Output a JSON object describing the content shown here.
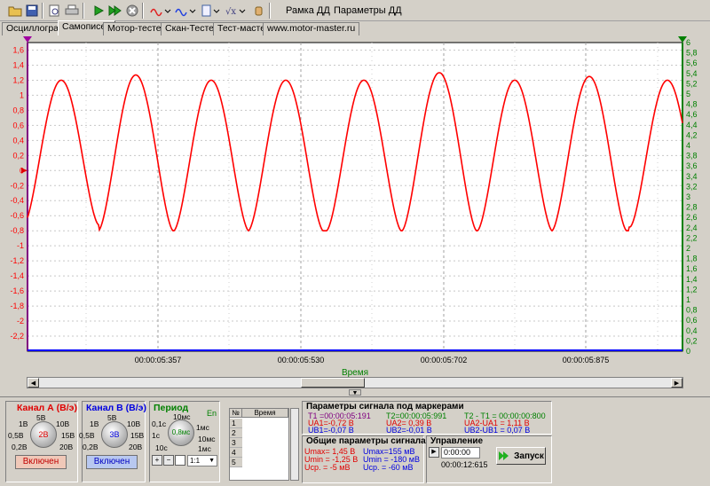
{
  "toolbar": {
    "icons": [
      "open-folder-icon",
      "save-icon",
      "preview-icon",
      "print-icon",
      "play-icon",
      "play-fast-icon",
      "stop-icon",
      "wave-red-icon",
      "wave-blue-icon",
      "document-icon",
      "function-icon",
      "hand-icon"
    ],
    "menu_ramka": "Рамка ДД",
    "menu_params": "Параметры ДД"
  },
  "tabs": [
    "Осциллограф",
    "Самописец",
    "Мотор-тестер",
    "Скан-Тестер",
    "Тест-мастер",
    "www.motor-master.ru"
  ],
  "active_tab": "Самописец",
  "colors": {
    "channel_a": "#ff0000",
    "channel_b": "#0000ff",
    "grid_bg": "#ffffff",
    "right_axis": "#008000"
  },
  "chart_data": {
    "type": "line",
    "x": [
      "00:00:05:357",
      "00:00:05:530",
      "00:00:05:702",
      "00:00:05:875"
    ],
    "xlabel": "Время",
    "left_axis_ticks": [
      "1,6",
      "1,4",
      "1,2",
      "1",
      "0,8",
      "0,6",
      "0,4",
      "0,2",
      "0",
      "-0,2",
      "-0,4",
      "-0,6",
      "-0,8",
      "-1",
      "-1,2",
      "-1,4",
      "-1,6",
      "-1,8",
      "-2",
      "-2,2"
    ],
    "right_axis_ticks": [
      "6",
      "5,8",
      "5,6",
      "5,4",
      "5,2",
      "5",
      "4,8",
      "4,6",
      "4,4",
      "4,2",
      "4",
      "3,8",
      "3,6",
      "3,4",
      "3,2",
      "3",
      "2,8",
      "2,6",
      "2,4",
      "2,2",
      "2",
      "1,8",
      "1,6",
      "1,4",
      "1,2",
      "1",
      "0,8",
      "0,6",
      "0,4",
      "0,2",
      "0"
    ],
    "ylim_a": [
      -2.4,
      1.7
    ],
    "ylim_b": [
      0,
      6
    ],
    "series": [
      {
        "name": "Канал A",
        "color": "#ff0000",
        "peaks": [
          1.2,
          1.27,
          1.2,
          1.2,
          1.2,
          1.3,
          1.2,
          1.25,
          1.2
        ],
        "troughs": [
          -0.72,
          -0.8,
          -0.8,
          -0.8,
          -0.8,
          -0.8,
          -0.8,
          -0.8,
          -0.75
        ]
      },
      {
        "name": "Канал B",
        "color": "#0000ff",
        "level": 0.0
      }
    ]
  },
  "channel_a": {
    "title": "Канал А (В/э)",
    "value": "2В",
    "ticks": [
      "1В",
      "0,5В",
      "0,2В",
      "5В",
      "10В",
      "15В",
      "20В"
    ],
    "button": "Включен"
  },
  "channel_b": {
    "title": "Канал B (В/э)",
    "value": "3В",
    "ticks": [
      "1В",
      "0,5В",
      "0,2В",
      "5В",
      "10В",
      "15В",
      "20В"
    ],
    "button": "Включен"
  },
  "period": {
    "title": "Период",
    "en": "En",
    "value": "0,8мс",
    "ticks": [
      "0,1с",
      "1с",
      "10с",
      "10мс",
      "1мс",
      "10мс",
      "1мс"
    ],
    "ratio": "1:1"
  },
  "marker_table": {
    "col_no": "№",
    "col_time": "Время",
    "rows": [
      "1",
      "2",
      "3",
      "4",
      "5"
    ]
  },
  "markers": {
    "title": "Параметры сигнала под маркерами",
    "t1": "T1 =00:00:05:191",
    "t2": "T2=00:00:05:991",
    "dt": "T2 - T1 = 00:00:00:800",
    "ua1": "UA1=-0,72 В",
    "ub1": "UB1=-0,07 В",
    "ua2": "UA2= 0,39 В",
    "ub2": "UB2=-0,01 В",
    "dua": "UA2-UA1 = 1,11 В",
    "dub": "UB2-UB1 = 0,07 В"
  },
  "general": {
    "title": "Общие параметры сигнала",
    "umax_a": "Umax= 1,45 В",
    "umin_a": "Umin = -1,25 В",
    "ucp_a": "Ucp. = -5 мВ",
    "umax_b": "Umax=155 мВ",
    "umin_b": "Umin = -180 мВ",
    "ucp_b": "Ucp. = -60 мВ"
  },
  "control": {
    "title": "Управление",
    "time_field": "0:00:00",
    "elapsed": "00:00:12:615",
    "start_button": "Запуск"
  }
}
